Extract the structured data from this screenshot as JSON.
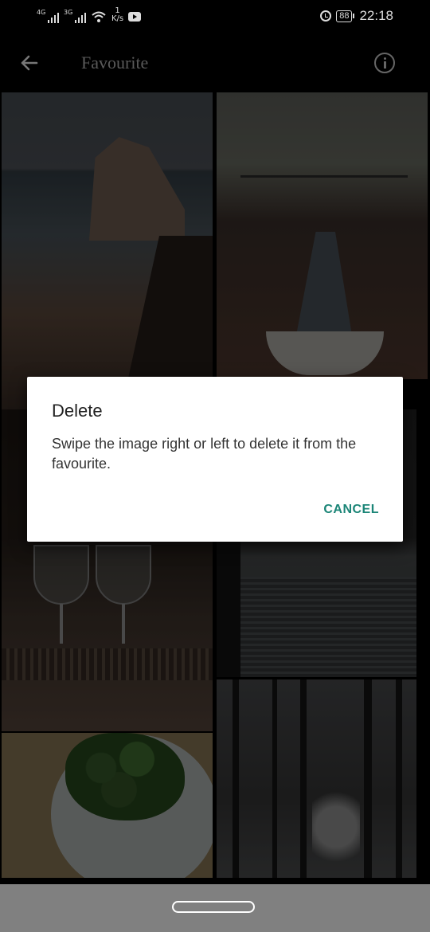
{
  "status_bar": {
    "network1_tag": "4G",
    "network2_tag": "3G",
    "speed_value": "1",
    "speed_unit": "K/s",
    "battery": "88",
    "time": "22:18",
    "icons": [
      "signal-icon",
      "wifi-icon",
      "youtube-icon",
      "alarm-icon",
      "battery-icon"
    ]
  },
  "app_bar": {
    "title": "Favourite",
    "icons": [
      "back-arrow-icon",
      "info-icon"
    ]
  },
  "grid": {
    "photos": [
      "sea-rock-photo",
      "dam-canyon-photo",
      "glasses-bar-photo",
      "city-river-photo",
      "broccoli-plate-photo",
      "forest-photo"
    ]
  },
  "dialog": {
    "title": "Delete",
    "message": "Swipe the image right or left to delete it from the favourite.",
    "cancel_label": "CANCEL",
    "accent_color": "#1b8577"
  }
}
